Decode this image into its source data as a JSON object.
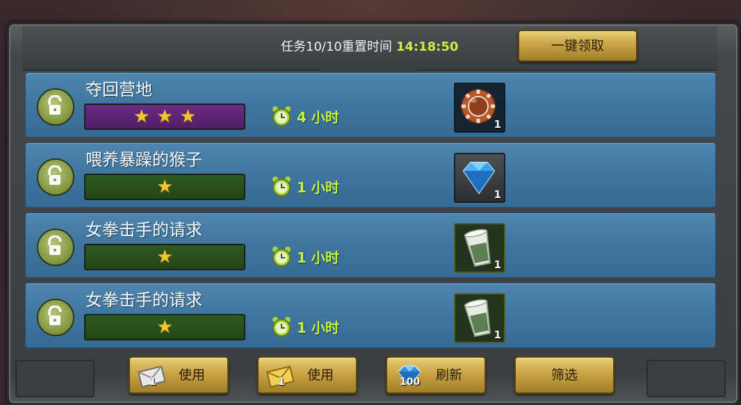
{
  "header": {
    "tasks_label": "任务10/10重置时间",
    "reset_time": "14:18:50",
    "claim_all_button": "一键领取"
  },
  "tasks": [
    {
      "title": "夺回营地",
      "stars": 3,
      "bar_color": "purple",
      "duration": "4 小时",
      "reward_icon": "brown-chip-icon",
      "reward_count": "1"
    },
    {
      "title": "喂养暴躁的猴子",
      "stars": 1,
      "bar_color": "green",
      "duration": "1 小时",
      "reward_icon": "blue-diamond-icon",
      "reward_count": "1"
    },
    {
      "title": "女拳击手的请求",
      "stars": 1,
      "bar_color": "green",
      "duration": "1 小时",
      "reward_icon": "green-cup-icon",
      "reward_count": "1"
    },
    {
      "title": "女拳击手的请求",
      "stars": 1,
      "bar_color": "green",
      "duration": "1 小时",
      "reward_icon": "green-cup-icon",
      "reward_count": "1"
    }
  ],
  "footer": {
    "buttons": [
      {
        "label": "使用",
        "icon": "white-envelope-icon",
        "count": "1"
      },
      {
        "label": "使用",
        "icon": "gold-envelope-icon",
        "count": "1"
      },
      {
        "label": "刷新",
        "icon": "blue-diamond-icon",
        "count": "100"
      },
      {
        "label": "筛选"
      }
    ]
  },
  "colors": {
    "accent_green": "#c6f046",
    "row_blue": "#3f76a0",
    "gold_button": "#caa344",
    "star": "#f3c531"
  }
}
